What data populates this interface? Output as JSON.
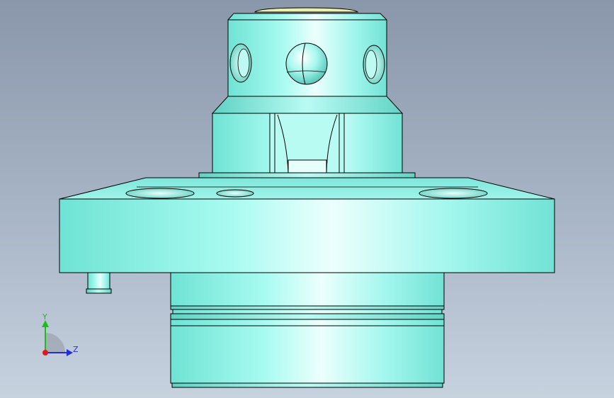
{
  "viewport": {
    "background_top": "#8a97ab",
    "background_bottom": "#c7d2df"
  },
  "model": {
    "body_color": "#8ff5e8",
    "highlight_color": "#e8fffc",
    "edge_color": "#000000"
  },
  "triad": {
    "y_label": "Y",
    "z_label": "Z",
    "y_color": "#18c018",
    "z_color": "#1f2fe0",
    "origin_color": "#e01818"
  }
}
